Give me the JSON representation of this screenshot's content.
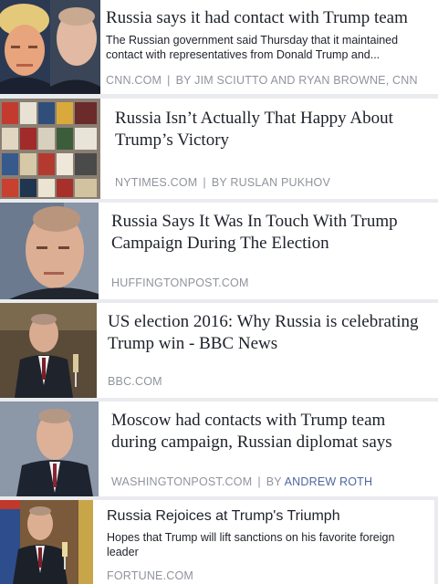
{
  "articles": [
    {
      "title": "Russia says it had contact with Trump team",
      "description": "The Russian government said Thursday that it maintained contact with representatives from Donald Trump and...",
      "source": "CNN.COM",
      "byline_prefix": "BY",
      "author": "JIM SCIUTTO AND RYAN BROWNE, CNN",
      "thumbnail_icon": "trump-putin-photo-icon"
    },
    {
      "title": "Russia Isn’t Actually That Happy About Trump’s Victory",
      "source": "NYTIMES.COM",
      "byline_prefix": "BY",
      "author": "RUSLAN PUKHOV",
      "thumbnail_icon": "newsstand-photo-icon"
    },
    {
      "title": "Russia Says It Was In Touch With Trump Campaign During The Election",
      "source": "HUFFINGTONPOST.COM",
      "thumbnail_icon": "putin-portrait-icon"
    },
    {
      "title": "US election 2016: Why Russia is celebrating Trump win - BBC News",
      "source": "BBC.COM",
      "thumbnail_icon": "putin-toast-photo-icon"
    },
    {
      "title": "Moscow had contacts with Trump team during campaign, Russian diplomat says",
      "source": "WASHINGTONPOST.COM",
      "byline_prefix": "BY",
      "author": "ANDREW ROTH",
      "thumbnail_icon": "putin-speech-photo-icon"
    },
    {
      "title": "Russia Rejoices at Trump's Triumph",
      "description": "Hopes that Trump will lift sanctions on his favorite foreign leader",
      "source": "FORTUNE.COM",
      "thumbnail_icon": "putin-champagne-photo-icon"
    }
  ],
  "colors": {
    "background": "#e9ebee",
    "title": "#1d2129",
    "meta": "#90949c",
    "author_link": "#4b67a1"
  }
}
